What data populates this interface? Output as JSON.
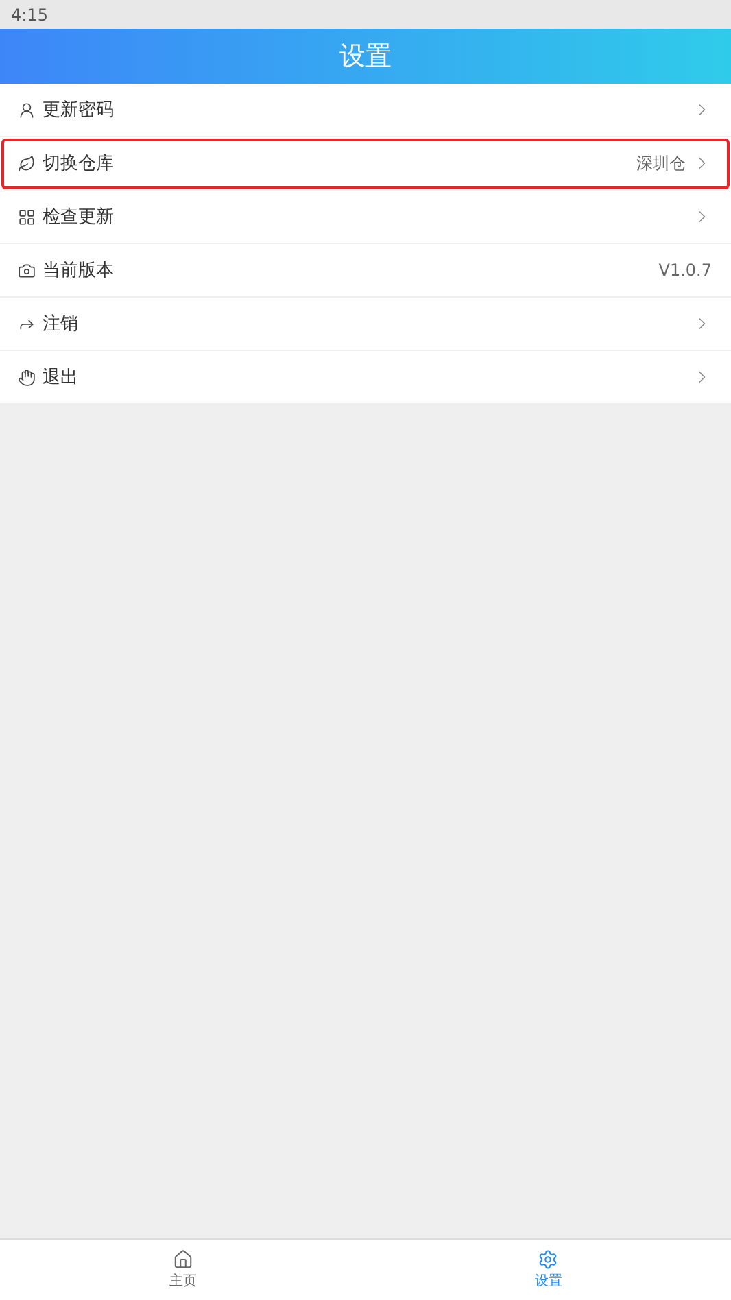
{
  "status_bar": {
    "time": "4:15"
  },
  "header": {
    "title": "设置"
  },
  "items": [
    {
      "label": "更新密码",
      "chevron": true,
      "highlighted": false
    },
    {
      "label": "切换仓库",
      "value": "深圳仓",
      "chevron": true,
      "highlighted": true
    },
    {
      "label": "检查更新",
      "chevron": true,
      "highlighted": false
    },
    {
      "label": "当前版本",
      "value": "V1.0.7",
      "chevron": false,
      "highlighted": false
    },
    {
      "label": "注销",
      "chevron": true,
      "highlighted": false
    },
    {
      "label": "退出",
      "chevron": true,
      "highlighted": false
    }
  ],
  "tab_bar": [
    {
      "label": "主页",
      "selected": false
    },
    {
      "label": "设置",
      "selected": true
    }
  ]
}
